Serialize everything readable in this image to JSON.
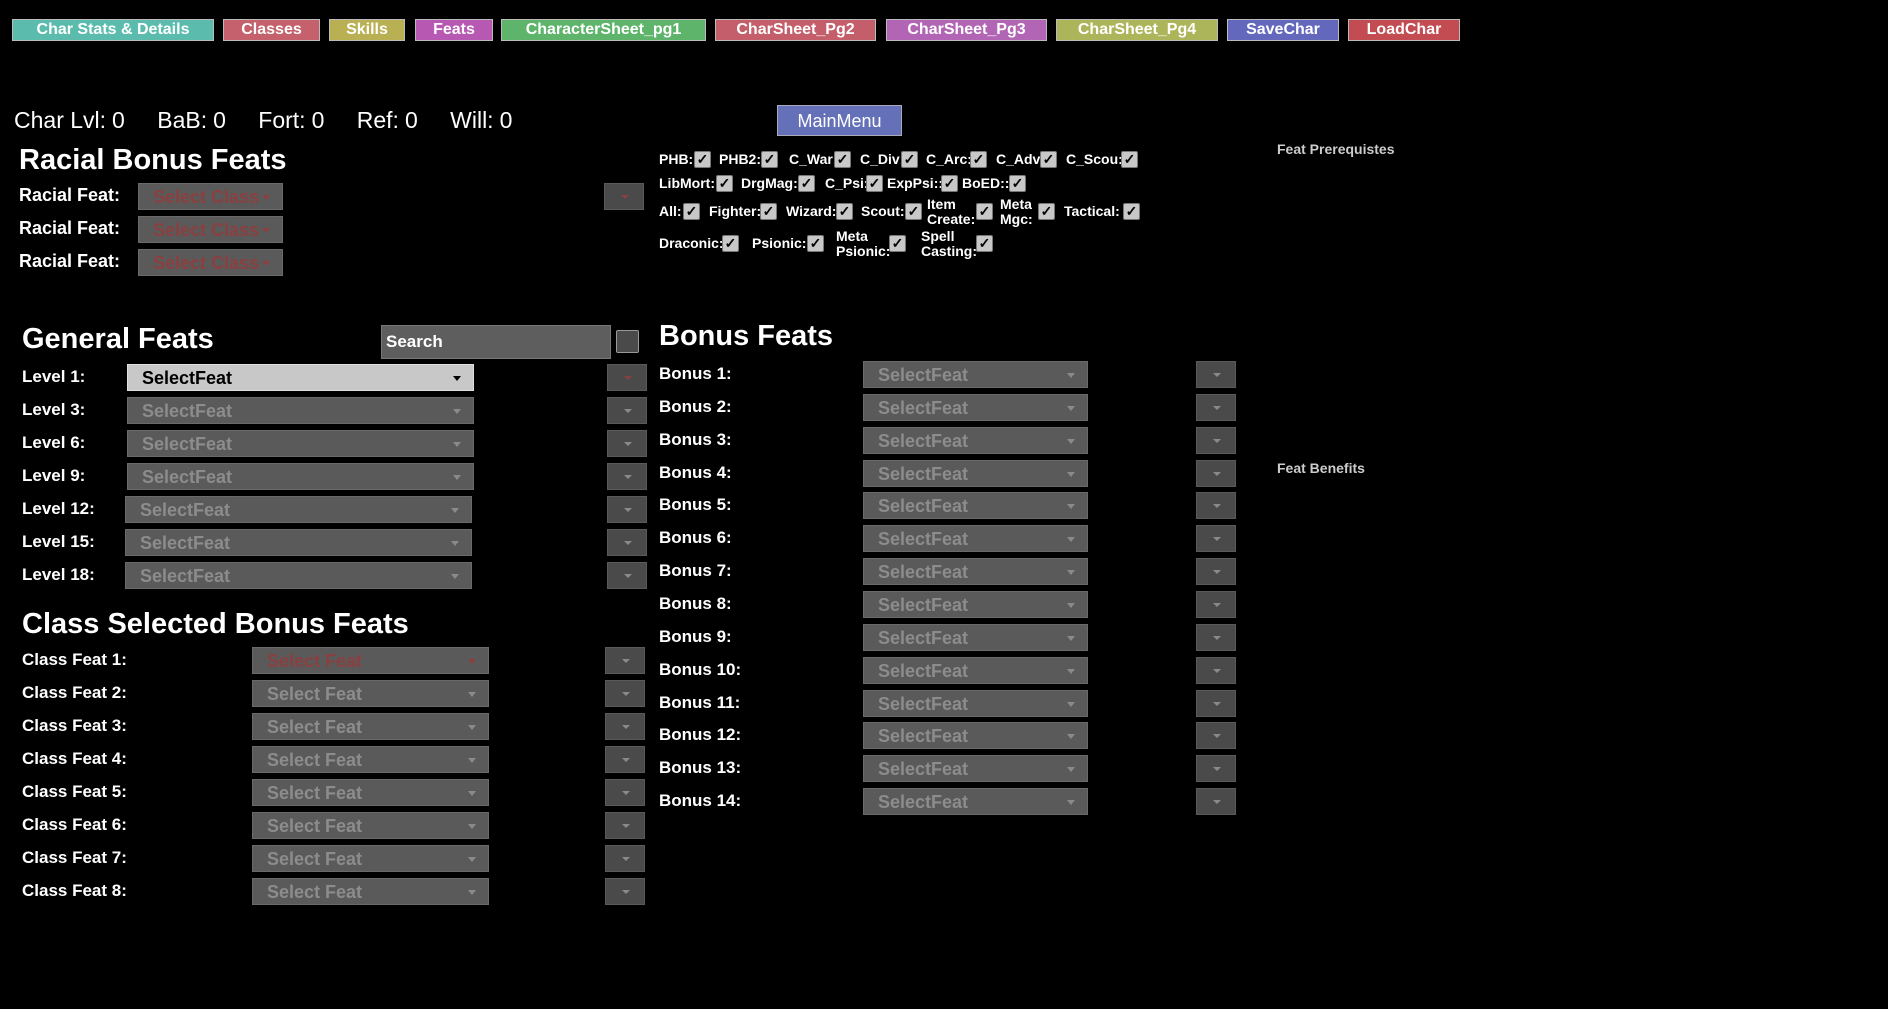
{
  "tabs": [
    {
      "label": "Char Stats & Details",
      "color": "#5bbcad"
    },
    {
      "label": "Classes",
      "color": "#c4616c"
    },
    {
      "label": "Skills",
      "color": "#b9b054"
    },
    {
      "label": "Feats",
      "color": "#b758b3"
    },
    {
      "label": "CharacterSheet_pg1",
      "color": "#5fb46b"
    },
    {
      "label": "CharSheet_Pg2",
      "color": "#c45e6a"
    },
    {
      "label": "CharSheet_Pg3",
      "color": "#b265b5"
    },
    {
      "label": "CharSheet_Pg4",
      "color": "#adb55a"
    },
    {
      "label": "SaveChar",
      "color": "#6468bd"
    },
    {
      "label": "LoadChar",
      "color": "#c24c52"
    }
  ],
  "stats": {
    "char_lvl_label": "Char Lvl:",
    "char_lvl": "0",
    "bab_label": "BaB:",
    "bab": "0",
    "fort_label": "Fort:",
    "fort": "0",
    "ref_label": "Ref:",
    "ref": "0",
    "will_label": "Will:",
    "will": "0"
  },
  "main_menu": "MainMenu",
  "racial": {
    "title": "Racial Bonus Feats",
    "rows": [
      {
        "label": "Racial Feat:",
        "value": "Select Class"
      },
      {
        "label": "Racial Feat:",
        "value": "Select Class"
      },
      {
        "label": "Racial Feat:",
        "value": "Select Class"
      }
    ]
  },
  "filters": {
    "row1": [
      "PHB:",
      "PHB2:",
      "C_War:",
      "C_Div:",
      "C_Arc:",
      "C_Adv:",
      "C_Scou:"
    ],
    "row2": [
      "LibMort:",
      "DrgMag:",
      "C_Psi:",
      "ExpPsi::",
      "BoED::"
    ],
    "row3": [
      "All:",
      "Fighter:",
      "Wizard:",
      "Scout:",
      "Item Create:",
      "Meta Mgc:",
      "Tactical:"
    ],
    "row4": [
      "Draconic:",
      "Psionic:",
      "Meta Psionic:",
      "Spell Casting:"
    ],
    "check": "✓"
  },
  "side": {
    "prereq": "Feat Prerequistes",
    "benefits": "Feat Benefits"
  },
  "general": {
    "title": "General Feats",
    "search_placeholder": "Search",
    "rows": [
      {
        "label": "Level 1:",
        "value": "SelectFeat"
      },
      {
        "label": "Level 3:",
        "value": "SelectFeat"
      },
      {
        "label": "Level 6:",
        "value": "SelectFeat"
      },
      {
        "label": "Level 9:",
        "value": "SelectFeat"
      },
      {
        "label": "Level 12:",
        "value": "SelectFeat"
      },
      {
        "label": "Level 15:",
        "value": "SelectFeat"
      },
      {
        "label": "Level 18:",
        "value": "SelectFeat"
      }
    ]
  },
  "class_bonus": {
    "title": "Class Selected Bonus Feats",
    "rows": [
      {
        "label": "Class Feat 1:",
        "value": "Select Feat"
      },
      {
        "label": "Class Feat 2:",
        "value": "Select Feat"
      },
      {
        "label": "Class Feat 3:",
        "value": "Select Feat"
      },
      {
        "label": "Class Feat 4:",
        "value": "Select Feat"
      },
      {
        "label": "Class Feat 5:",
        "value": "Select Feat"
      },
      {
        "label": "Class Feat 6:",
        "value": "Select Feat"
      },
      {
        "label": "Class Feat 7:",
        "value": "Select Feat"
      },
      {
        "label": "Class Feat 8:",
        "value": "Select Feat"
      }
    ]
  },
  "bonus": {
    "title": "Bonus Feats",
    "rows": [
      {
        "label": "Bonus 1:",
        "value": "SelectFeat"
      },
      {
        "label": "Bonus 2:",
        "value": "SelectFeat"
      },
      {
        "label": "Bonus 3:",
        "value": "SelectFeat"
      },
      {
        "label": "Bonus 4:",
        "value": "SelectFeat"
      },
      {
        "label": "Bonus 5:",
        "value": "SelectFeat"
      },
      {
        "label": "Bonus 6:",
        "value": "SelectFeat"
      },
      {
        "label": "Bonus 7:",
        "value": "SelectFeat"
      },
      {
        "label": "Bonus 8:",
        "value": "SelectFeat"
      },
      {
        "label": "Bonus 9:",
        "value": "SelectFeat"
      },
      {
        "label": "Bonus 10:",
        "value": "SelectFeat"
      },
      {
        "label": "Bonus 11:",
        "value": "SelectFeat"
      },
      {
        "label": "Bonus 12:",
        "value": "SelectFeat"
      },
      {
        "label": "Bonus 13:",
        "value": "SelectFeat"
      },
      {
        "label": "Bonus 14:",
        "value": "SelectFeat"
      }
    ]
  }
}
